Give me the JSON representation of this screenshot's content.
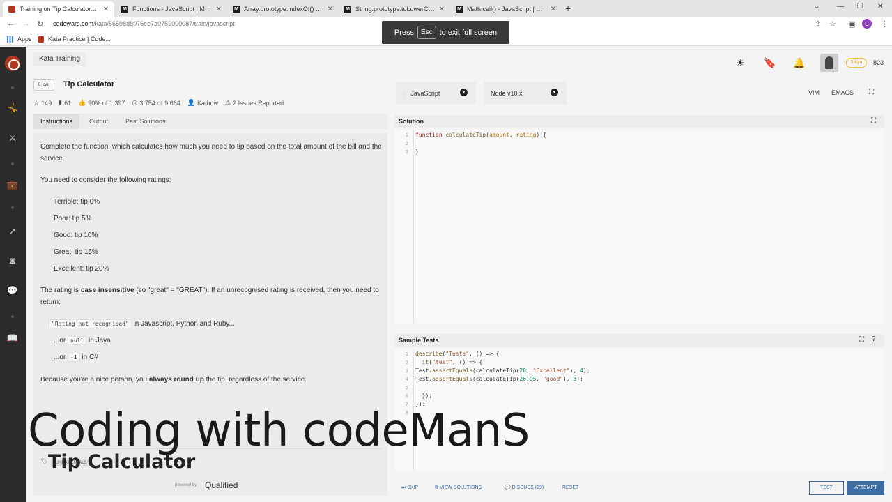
{
  "browser": {
    "tabs": [
      {
        "title": "Training on Tip Calculator | Code",
        "icon": "codewars-favicon",
        "active": true
      },
      {
        "title": "Functions - JavaScript | MDN",
        "icon": "mdn-favicon",
        "active": false
      },
      {
        "title": "Array.prototype.indexOf() - Java",
        "icon": "mdn-favicon",
        "active": false
      },
      {
        "title": "String.prototype.toLowerCase() -",
        "icon": "mdn-favicon",
        "active": false
      },
      {
        "title": "Math.ceil() - JavaScript | MDN",
        "icon": "mdn-favicon",
        "active": false
      }
    ],
    "url_host": "codewars.com",
    "url_path": "/kata/56598d8076ee7a0759000087/train/javascript",
    "profile_initial": "C",
    "bookmarks": [
      {
        "label": "Apps",
        "icon": "apps-grid-icon"
      },
      {
        "label": "Kata Practice | Code...",
        "icon": "codewars-favicon"
      }
    ],
    "fullscreen_toast": {
      "before": "Press",
      "key": "Esc",
      "after": "to exit full screen"
    }
  },
  "header": {
    "breadcrumb": "Kata Training",
    "kyu": "8 kyu",
    "title": "Tip Calculator",
    "stats": {
      "stars": "149",
      "favorites": "61",
      "satisfaction": "90% of 1,397",
      "completed": "3,754",
      "completed_of": "of",
      "attempted": "9,664",
      "author": "Katbow",
      "issues": "2 Issues Reported"
    },
    "theme_icon": "sun-icon",
    "rank": "5 kyu",
    "honor": "823"
  },
  "left_tabs": [
    "Instructions",
    "Output",
    "Past Solutions"
  ],
  "instructions": {
    "p1": "Complete the function, which calculates how much you need to tip based on the total amount of the bill and the service.",
    "p2": "You need to consider the following ratings:",
    "ratings": [
      "Terrible: tip 0%",
      "Poor: tip 5%",
      "Good: tip 10%",
      "Great: tip 15%",
      "Excellent: tip 20%"
    ],
    "p3_a": "The rating is ",
    "p3_b": "case insensitive",
    "p3_c": " (so \"great\" = \"GREAT\"). If an unrecognised rating is received, then you need to return:",
    "returns": [
      {
        "prefix": "",
        "code": "\"Rating not recognised\"",
        "suffix": " in Javascript, Python and Ruby..."
      },
      {
        "prefix": "...or ",
        "code": "null",
        "suffix": " in Java"
      },
      {
        "prefix": "...or ",
        "code": "-1",
        "suffix": " in C#"
      }
    ],
    "p4_a": "Because you're a nice person, you ",
    "p4_b": "always round up",
    "p4_c": " the tip, regardless of the service.",
    "tag": "FUNDAMENTALS",
    "powered_by": "powered by",
    "qualified": "Qualified"
  },
  "overlay": {
    "main": "Coding with codeManS",
    "sub": "Tip Calculator"
  },
  "editor": {
    "language": "JavaScript",
    "version": "Node v10.x",
    "modes": [
      "VIM",
      "EMACS"
    ],
    "solution_label": "Solution",
    "solution_lines": [
      "1",
      "2",
      "3"
    ],
    "sample_label": "Sample Tests",
    "sample_lines": [
      "1",
      "2",
      "3",
      "4",
      "5",
      "6",
      "7",
      "8"
    ]
  },
  "actions": {
    "skip": "SKIP",
    "view_solutions": "VIEW SOLUTIONS",
    "discuss": "DISCUSS (29)",
    "reset": "RESET",
    "test": "TEST",
    "attempt": "ATTEMPT"
  }
}
